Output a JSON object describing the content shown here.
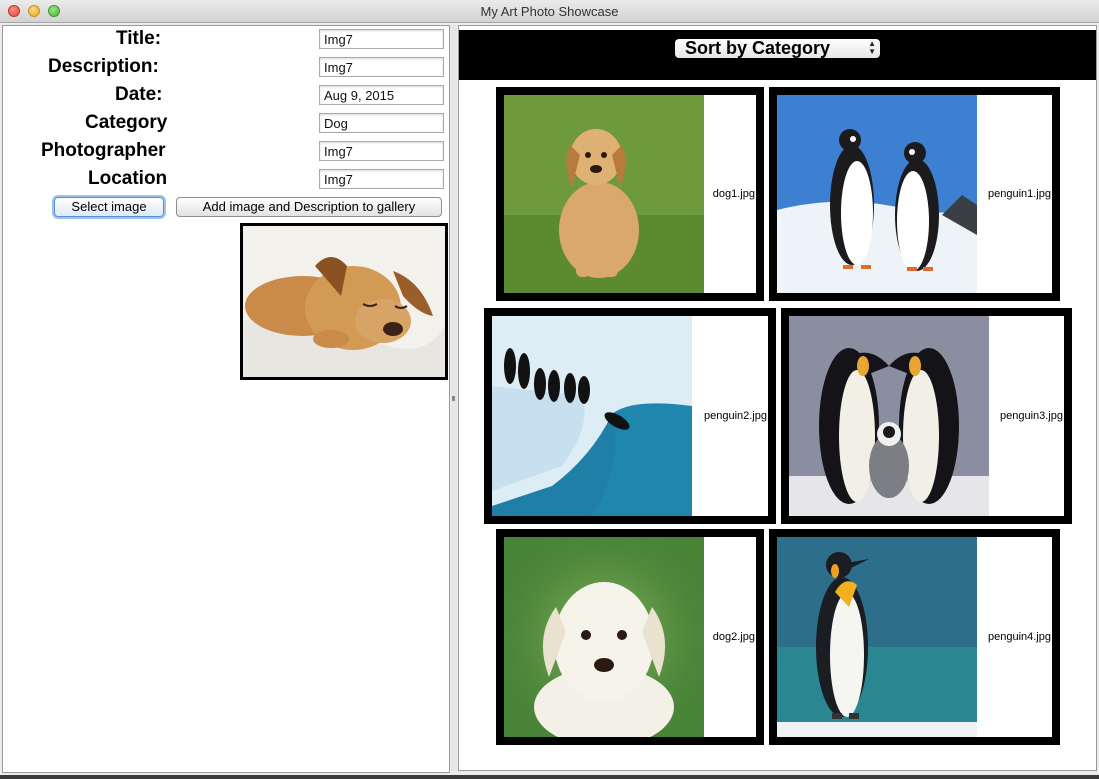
{
  "window": {
    "title": "My Art Photo Showcase"
  },
  "form": {
    "fields": [
      {
        "label": "Title:",
        "value": "Img7"
      },
      {
        "label": "Description:",
        "value": "Img7"
      },
      {
        "label": "Date:",
        "value": "Aug 9, 2015"
      },
      {
        "label": "Category",
        "value": "Dog"
      },
      {
        "label": "Photographer",
        "value": "Img7"
      },
      {
        "label": "Location",
        "value": "Img7"
      }
    ],
    "select_button": "Select image",
    "add_button": "Add image and Description to gallery"
  },
  "gallery": {
    "sort_label": "Sort by Category",
    "items": [
      {
        "filename": "dog1.jpg"
      },
      {
        "filename": "penguin1.jpg"
      },
      {
        "filename": "penguin2.jpg"
      },
      {
        "filename": "penguin3.jpg"
      },
      {
        "filename": "dog2.jpg"
      },
      {
        "filename": "penguin4.jpg"
      }
    ]
  }
}
